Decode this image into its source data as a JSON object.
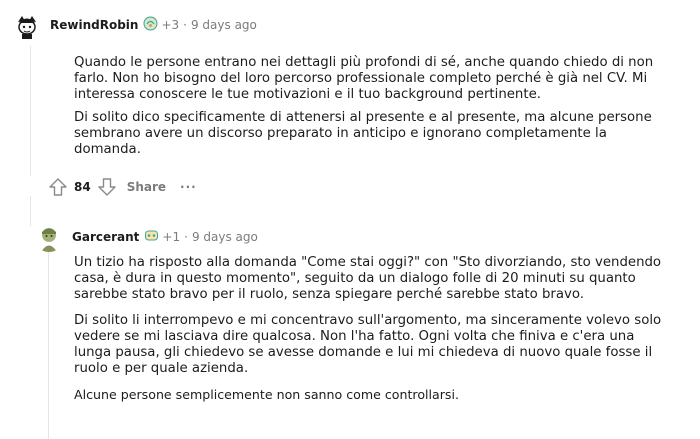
{
  "comment1": {
    "username": "RewindRobin",
    "karma": "+3",
    "time": "9 days ago",
    "paragraphs": [
      "Quando le persone entrano nei dettagli più profondi di sé, anche quando chiedo di non farlo. Non ho bisogno del loro percorso professionale completo perché è già nel CV. Mi interessa conoscere le tue motivazioni e il tuo background pertinente.",
      "Di solito dico specificamente di attenersi al presente e al presente, ma alcune persone sembrano avere un discorso preparato in anticipo e ignorano completamente la domanda."
    ],
    "votes": "84",
    "share_label": "Share",
    "more_label": "···"
  },
  "comment2": {
    "username": "Garcerant",
    "karma": "+1",
    "time": "9 days ago",
    "paragraphs": [
      "Un tizio ha risposto alla domanda \"Come stai oggi?\" con \"Sto divorziando, sto vendendo casa, è dura in questo momento\", seguito da un dialogo folle di 20 minuti su quanto sarebbe stato bravo per il ruolo, senza spiegare perché sarebbe stato bravo.",
      "Di solito li interrompevo e mi concentravo sull'argomento, ma sinceramente volevo solo vedere se mi lasciava dire qualcosa. Non l'ha fatto. Ogni volta che finiva e c'era una lunga pausa, gli chiedevo se avesse domande e lui mi chiedeva di nuovo quale fosse il ruolo e per quale azienda.",
      "Alcune persone semplicemente non sanno come controllarsi."
    ]
  },
  "icons": {
    "upvote": "upvote-icon",
    "downvote": "downvote-icon",
    "flair": "flair-icon"
  }
}
